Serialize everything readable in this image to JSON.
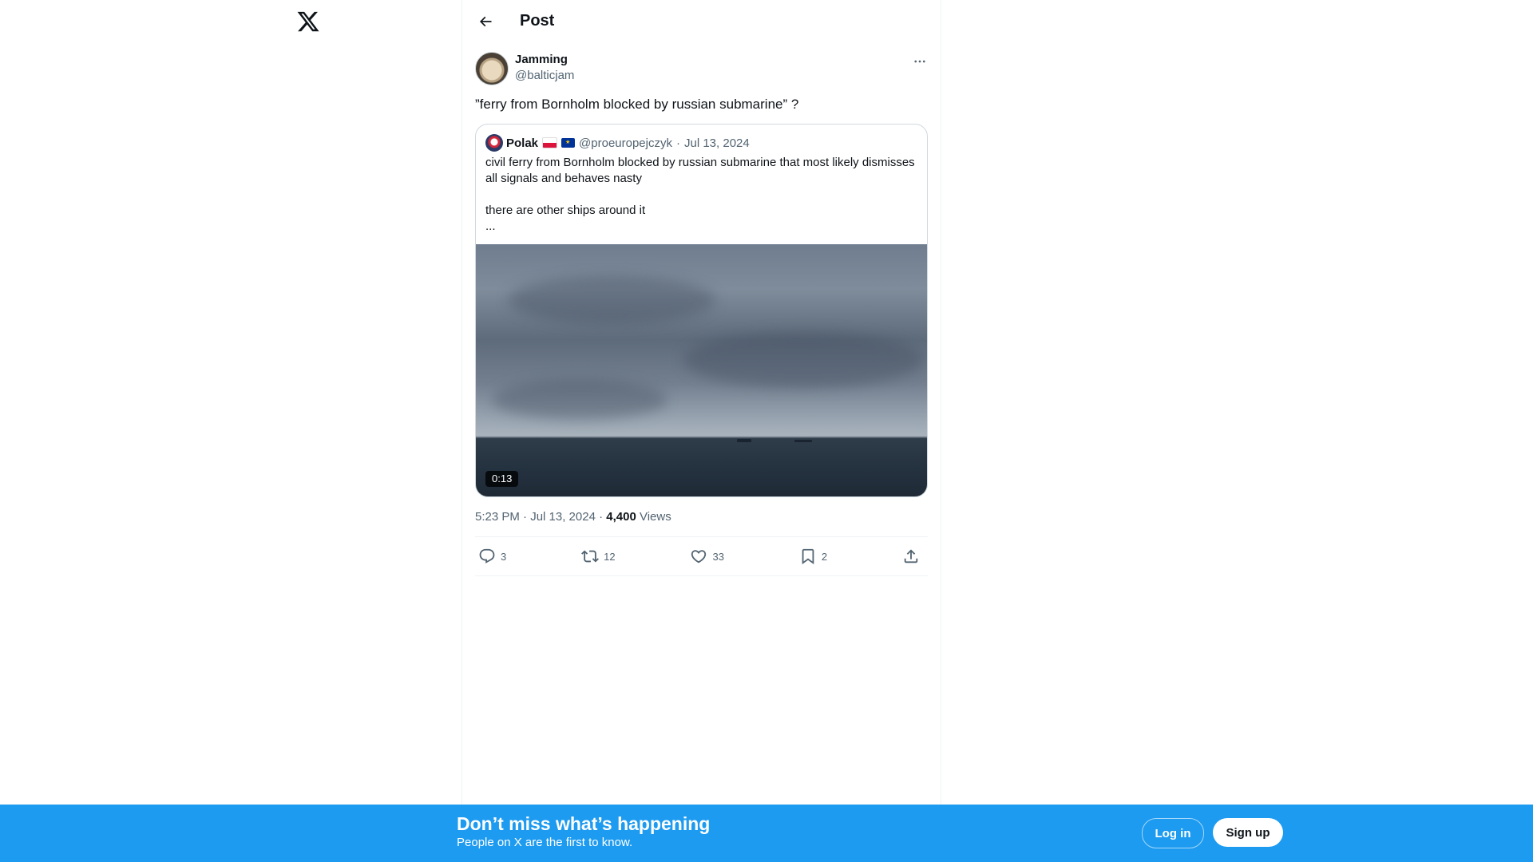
{
  "nav": {
    "logo_icon": "x-logo-icon"
  },
  "header": {
    "title": "Post",
    "back_icon": "arrow-left-icon"
  },
  "post": {
    "author_name": "Jamming",
    "author_handle": "@balticjam",
    "text": "”ferry from Bornholm blocked by russian submarine” ?",
    "quote": {
      "author_name": "Polak",
      "flags": [
        "flag-poland",
        "flag-eu"
      ],
      "author_handle": "@proeuropejczyk",
      "separator": "·",
      "date": "Jul 13, 2024",
      "text": "civil ferry from Bornholm blocked by russian submarine that most likely dismisses all signals and behaves nasty\n\nthere are other ships around it\n...",
      "video_duration": "0:13"
    },
    "timestamp": "5:23 PM · Jul 13, 2024 · ",
    "views_count": "4,400",
    "views_label": " Views",
    "actions": {
      "replies": "3",
      "reposts": "12",
      "likes": "33",
      "bookmarks": "2"
    }
  },
  "banner": {
    "title": "Don’t miss what’s happening",
    "subtitle": "People on X are the first to know.",
    "login_label": "Log in",
    "signup_label": "Sign up"
  },
  "colors": {
    "accent": "#1d9bf0",
    "text": "#0f1419",
    "muted": "#536471"
  }
}
